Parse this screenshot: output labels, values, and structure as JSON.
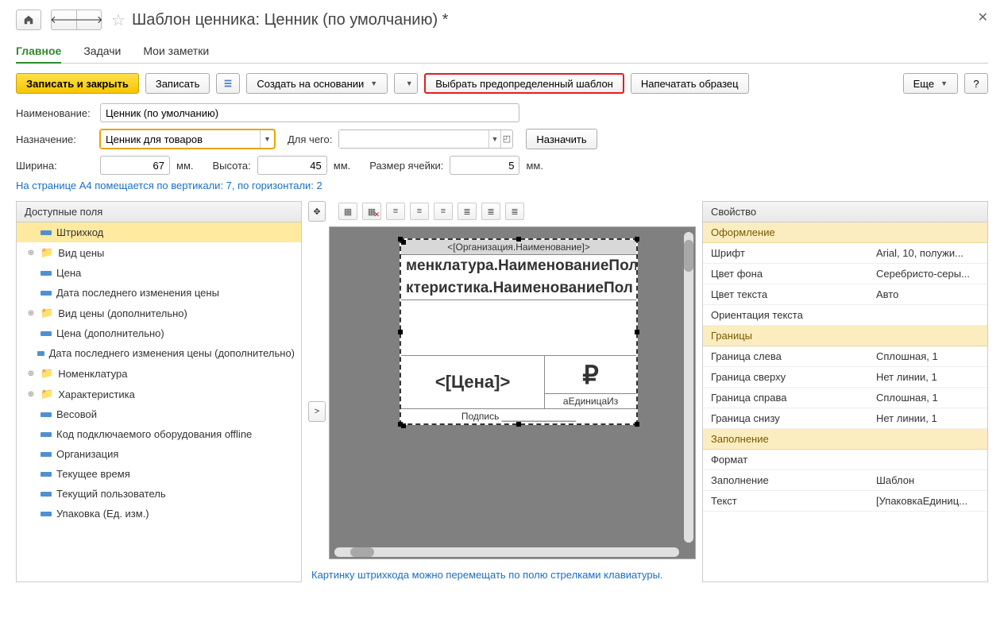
{
  "title": "Шаблон ценника: Ценник (по умолчанию) *",
  "tabs": [
    "Главное",
    "Задачи",
    "Мои заметки"
  ],
  "toolbar": {
    "save_close": "Записать и закрыть",
    "save": "Записать",
    "create_based": "Создать на основании",
    "select_predef": "Выбрать предопределенный шаблон",
    "print_sample": "Напечатать образец",
    "more": "Еще"
  },
  "fields": {
    "name_label": "Наименование:",
    "name_value": "Ценник (по умолчанию)",
    "purpose_label": "Назначение:",
    "purpose_value": "Ценник для товаров",
    "forwhat_label": "Для чего:",
    "forwhat_value": "",
    "assign_btn": "Назначить",
    "width_label": "Ширина:",
    "width_value": "67",
    "height_label": "Высота:",
    "height_value": "45",
    "cell_label": "Размер ячейки:",
    "cell_value": "5",
    "mm": "мм."
  },
  "info_text": "На странице А4 помещается по вертикали: 7, по горизонтали: 2",
  "left_panel_header": "Доступные поля",
  "tree": [
    {
      "label": "Штрихкод",
      "type": "field",
      "selected": true
    },
    {
      "label": "Вид цены",
      "type": "folder",
      "expandable": true
    },
    {
      "label": "Цена",
      "type": "field"
    },
    {
      "label": "Дата последнего изменения цены",
      "type": "field"
    },
    {
      "label": "Вид цены (дополнительно)",
      "type": "folder",
      "expandable": true
    },
    {
      "label": "Цена (дополнительно)",
      "type": "field"
    },
    {
      "label": "Дата последнего изменения цены (дополнительно)",
      "type": "field"
    },
    {
      "label": "Номенклатура",
      "type": "folder",
      "expandable": true
    },
    {
      "label": "Характеристика",
      "type": "folder",
      "expandable": true
    },
    {
      "label": "Весовой",
      "type": "field"
    },
    {
      "label": "Код подключаемого оборудования offline",
      "type": "field"
    },
    {
      "label": "Организация",
      "type": "field"
    },
    {
      "label": "Текущее время",
      "type": "field"
    },
    {
      "label": "Текущий пользователь",
      "type": "field"
    },
    {
      "label": "Упаковка (Ед. изм.)",
      "type": "field"
    }
  ],
  "label_template": {
    "org": "<[Организация.Наименование]>",
    "nom": "менклатура.НаименованиеПол",
    "char": "ктеристика.НаименованиеПол",
    "price": "<[Цена]>",
    "ruble": "₽",
    "unit": "аЕдиницаИз",
    "sign": "Подпись ______________"
  },
  "hint": "Картинку штрихкода можно перемещать по полю стрелками клавиатуры.",
  "right_panel_header": "Свойство",
  "prop_sections": [
    {
      "title": "Оформление",
      "rows": [
        {
          "n": "Шрифт",
          "v": "Arial, 10, полужи..."
        },
        {
          "n": "Цвет фона",
          "v": "Серебристо-серы..."
        },
        {
          "n": "Цвет текста",
          "v": "Авто"
        },
        {
          "n": "Ориентация текста",
          "v": ""
        }
      ]
    },
    {
      "title": "Границы",
      "rows": [
        {
          "n": "Граница слева",
          "v": "Сплошная, 1"
        },
        {
          "n": "Граница сверху",
          "v": "Нет линии, 1"
        },
        {
          "n": "Граница справа",
          "v": "Сплошная, 1"
        },
        {
          "n": "Граница снизу",
          "v": "Нет линии, 1"
        }
      ]
    },
    {
      "title": "Заполнение",
      "rows": [
        {
          "n": "Формат",
          "v": ""
        },
        {
          "n": "Заполнение",
          "v": "Шаблон"
        },
        {
          "n": "Текст",
          "v": "[УпаковкаЕдиниц..."
        }
      ]
    }
  ]
}
